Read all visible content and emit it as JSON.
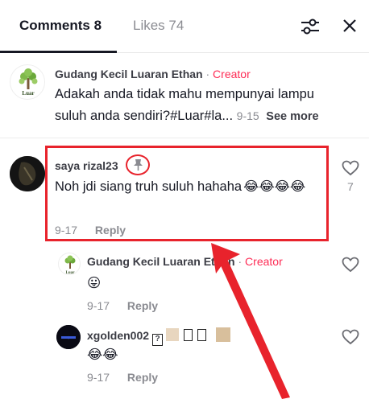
{
  "tabs": {
    "comments_label": "Comments 8",
    "likes_label": "Likes 74"
  },
  "icons": {
    "filter": "sliders-icon",
    "close": "close-icon",
    "pin": "pin-icon",
    "heart": "heart-outline-icon"
  },
  "colors": {
    "creator": "#fe2c55",
    "annotation": "#e8232c"
  },
  "comments": [
    {
      "author": "Gudang Kecil Luaran Ethan",
      "badge": "Creator",
      "text": "Adakah anda tidak mahu mempunyai lampu suluh anda sendiri?#Luar#la...",
      "date": "9-15",
      "more": "See more",
      "avatar_logo_text": "Luar"
    },
    {
      "author": "saya rizal23",
      "text": "Noh jdi siang truh suluh hahaha",
      "emoji": "😂😂😂😂",
      "date": "9-17",
      "reply": "Reply",
      "likes": "7",
      "pinned": true
    }
  ],
  "replies": [
    {
      "author": "Gudang Kecil Luaran Ethan",
      "badge": "Creator",
      "emoji": "😛",
      "date": "9-17",
      "reply": "Reply",
      "avatar_logo_text": "Luar"
    },
    {
      "author": "xgolden002",
      "emoji": "😂😂",
      "date": "9-17",
      "reply": "Reply"
    }
  ]
}
